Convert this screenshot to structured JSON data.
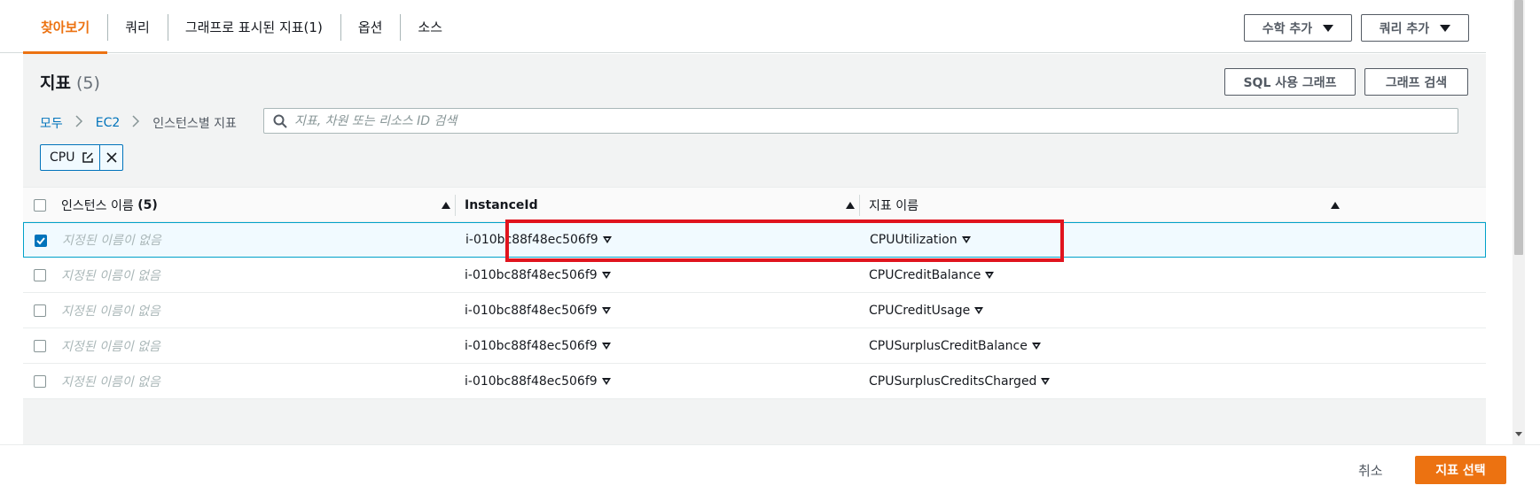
{
  "tabs": [
    {
      "label": "찾아보기",
      "active": true
    },
    {
      "label": "쿼리"
    },
    {
      "label": "그래프로 표시된 지표(1)"
    },
    {
      "label": "옵션"
    },
    {
      "label": "소스"
    }
  ],
  "toolbar": {
    "add_math_label": "수학 추가",
    "add_query_label": "쿼리 추가"
  },
  "panel": {
    "title": "지표",
    "count": "(5)",
    "sql_graph_label": "SQL 사용 그래프",
    "graph_search_label": "그래프 검색"
  },
  "breadcrumb": {
    "all": "모두",
    "ec2": "EC2",
    "current": "인스턴스별 지표"
  },
  "search": {
    "placeholder": "지표, 차원 또는 리소스 ID 검색",
    "value": ""
  },
  "filter_token": {
    "label": "CPU"
  },
  "table": {
    "columns": [
      {
        "label": "인스턴스 이름",
        "count": "(5)"
      },
      {
        "label": "InstanceId"
      },
      {
        "label": "지표 이름"
      }
    ],
    "rows": [
      {
        "name": "지정된 이름이 없음",
        "instance_id": "i-010bc88f48ec506f9",
        "metric": "CPUUtilization",
        "checked": true
      },
      {
        "name": "지정된 이름이 없음",
        "instance_id": "i-010bc88f48ec506f9",
        "metric": "CPUCreditBalance",
        "checked": false
      },
      {
        "name": "지정된 이름이 없음",
        "instance_id": "i-010bc88f48ec506f9",
        "metric": "CPUCreditUsage",
        "checked": false
      },
      {
        "name": "지정된 이름이 없음",
        "instance_id": "i-010bc88f48ec506f9",
        "metric": "CPUSurplusCreditBalance",
        "checked": false
      },
      {
        "name": "지정된 이름이 없음",
        "instance_id": "i-010bc88f48ec506f9",
        "metric": "CPUSurplusCreditsCharged",
        "checked": false
      }
    ]
  },
  "footer": {
    "cancel_label": "취소",
    "select_label": "지표 선택"
  },
  "colors": {
    "accent": "#ec7211",
    "link": "#0073bb",
    "highlight": "#e0141e"
  }
}
